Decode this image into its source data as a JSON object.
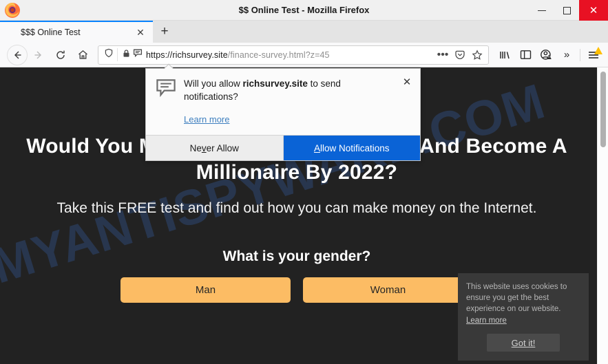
{
  "window": {
    "title": "$$ Online Test - Mozilla Firefox",
    "minimize_label": "—",
    "maximize_label": "□",
    "close_label": "✕",
    "app_icon": "firefox-logo"
  },
  "tabs": {
    "items": [
      {
        "title": "$$$ Online Test",
        "close_label": "✕"
      }
    ],
    "new_tab_label": "+"
  },
  "toolbar": {
    "back_label": "←",
    "forward_label": "→",
    "reload_label": "⟳",
    "home_label": "⌂",
    "library_icon": "library-icon",
    "sidebar_icon": "sidebar-icon",
    "account_icon": "account-warning-icon",
    "overflow_label": "»",
    "menu_icon": "hamburger-menu-icon"
  },
  "urlbar": {
    "shield_icon": "tracking-protection-shield-icon",
    "lock_icon": "lock-icon",
    "permission_icon": "notification-permission-icon",
    "scheme_host": "https://richsurvey.site",
    "path": "/finance-survey.html?z=45",
    "page_actions_label": "•••",
    "pocket_icon": "pocket-icon",
    "bookmark_icon": "star-icon"
  },
  "doorhanger": {
    "icon": "speech-bubble-icon",
    "message_prefix": "Will you allow ",
    "message_host": "richsurvey.site",
    "message_suffix": " to send notifications?",
    "learn_more": "Learn more",
    "close_label": "✕",
    "never_allow_pre": "Ne",
    "never_allow_accesskey": "v",
    "never_allow_post": "er Allow",
    "allow_accesskey": "A",
    "allow_post": "llow Notifications"
  },
  "page": {
    "watermark": "MYANTISPYWARE.COM",
    "headline": "Would You Make A Great Career Online And Become A Millionaire By 2022?",
    "subhead": "Take this FREE test and find out how you can make money on the Internet.",
    "question": "What is your gender?",
    "choices": [
      {
        "label": "Man"
      },
      {
        "label": "Woman"
      }
    ],
    "accent_color": "#fcbc64",
    "background_color": "#222222"
  },
  "cookie_notice": {
    "text": "This website uses cookies to ensure you get the best experience on our website. ",
    "learn_more": "Learn more",
    "button_label": "Got it!"
  }
}
